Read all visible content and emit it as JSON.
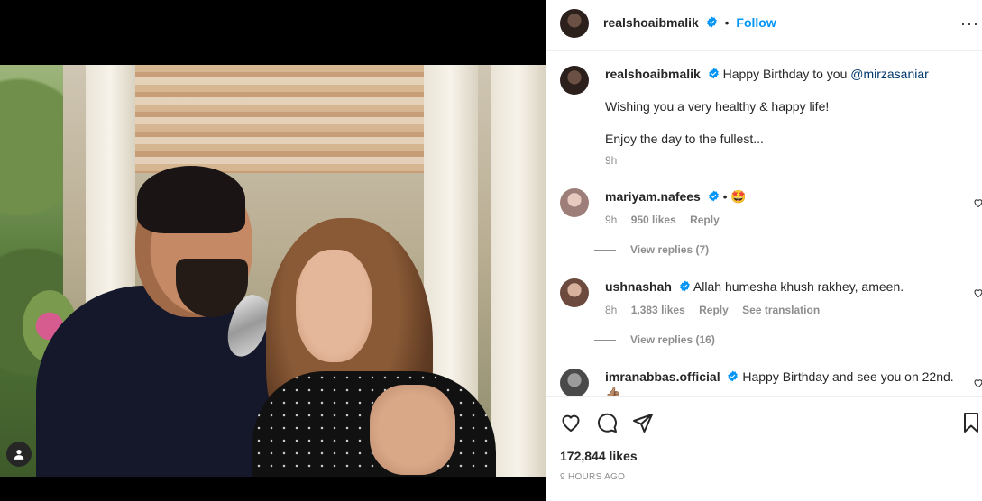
{
  "post": {
    "username": "realshoaibmalik",
    "follow_label": "Follow",
    "separator": "•",
    "more_label": "···"
  },
  "caption": {
    "username": "realshoaibmalik",
    "text_prefix": "Happy Birthday to you ",
    "mention": "@mirzasaniar",
    "line2": "Wishing you a very healthy & happy life!",
    "line3": "Enjoy the day to the fullest...",
    "time": "9h"
  },
  "comments": [
    {
      "username": "mariyam.nafees",
      "text": "• 🤩",
      "time": "9h",
      "likes": "950 likes",
      "reply": "Reply",
      "view_replies": "View replies (7)"
    },
    {
      "username": "ushnashah",
      "text": "Allah humesha khush rakhey, ameen.",
      "time": "8h",
      "likes": "1,383 likes",
      "reply": "Reply",
      "translation": "See translation",
      "view_replies": "View replies (16)"
    },
    {
      "username": "imranabbas.official",
      "text": "Happy Birthday and see you on 22nd.👍🏽",
      "text_line2": "😁"
    }
  ],
  "footer": {
    "likes": "172,844 likes",
    "time_ago": "9 HOURS AGO"
  },
  "icons": {
    "verified": "verified-badge-icon",
    "heart": "heart-icon",
    "comment": "comment-icon",
    "share": "share-icon",
    "bookmark": "bookmark-icon",
    "user_tag": "user-tag-icon"
  },
  "colors": {
    "link": "#0095f6",
    "mention": "#00376b",
    "muted": "#8e8e8e",
    "text": "#262626"
  }
}
